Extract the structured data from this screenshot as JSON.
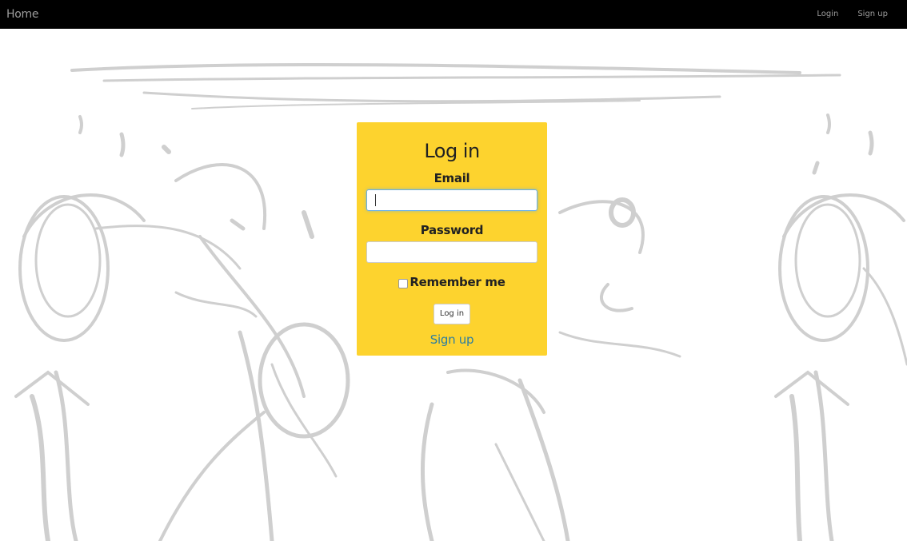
{
  "nav": {
    "brand": "Home",
    "links": [
      "Login",
      "Sign up"
    ]
  },
  "login": {
    "title": "Log in",
    "email_label": "Email",
    "email_value": "",
    "password_label": "Password",
    "password_value": "",
    "remember_label": "Remember me",
    "remember_checked": false,
    "submit_label": "Log in",
    "signup_link": "Sign up"
  },
  "colors": {
    "navbar": "#000000",
    "nav_text": "#9d9d9d",
    "card": "#fdd32e",
    "link": "#2d7ea0",
    "sketch": "#cfcfcf"
  }
}
